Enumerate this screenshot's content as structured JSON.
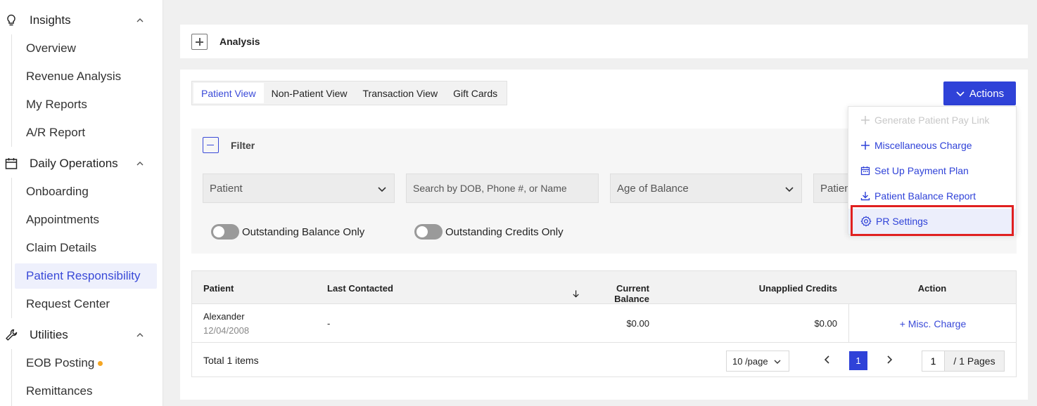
{
  "sidebar": {
    "groups": [
      {
        "label": "Insights",
        "items": [
          "Overview",
          "Revenue Analysis",
          "My Reports",
          "A/R Report"
        ]
      },
      {
        "label": "Daily Operations",
        "items": [
          "Onboarding",
          "Appointments",
          "Claim Details",
          "Patient Responsibility",
          "Request Center"
        ]
      },
      {
        "label": "Utilities",
        "items": [
          "EOB Posting",
          "Remittances"
        ]
      }
    ],
    "active_item": "Patient Responsibility"
  },
  "analysis": {
    "title": "Analysis"
  },
  "tabs": [
    "Patient View",
    "Non-Patient View",
    "Transaction View",
    "Gift Cards"
  ],
  "active_tab": "Patient View",
  "actions_label": "Actions",
  "filter": {
    "title": "Filter",
    "patient_select": "Patient",
    "search_placeholder": "Search by DOB, Phone #, or Name",
    "age_select": "Age of Balance",
    "fourth_select": "Patien",
    "toggle_outstanding_balance": "Outstanding Balance Only",
    "toggle_outstanding_credits": "Outstanding Credits Only"
  },
  "table": {
    "columns": [
      "Patient",
      "Last Contacted",
      "Current Balance",
      "Unapplied Credits",
      "Action"
    ],
    "rows": [
      {
        "patient_name": "Alexander",
        "patient_dob": "12/04/2008",
        "last_contacted": "-",
        "current_balance": "$0.00",
        "unapplied_credits": "$0.00",
        "action": "+ Misc. Charge"
      }
    ],
    "total": "Total 1 items",
    "page_size": "10 /page",
    "current_page": "1",
    "goto_page": "1",
    "total_pages": "/ 1 Pages"
  },
  "actions_menu": {
    "items": [
      "Generate Patient Pay Link",
      "Miscellaneous Charge",
      "Set Up Payment Plan",
      "Patient Balance Report",
      "PR Settings"
    ],
    "disabled_item": "Generate Patient Pay Link",
    "highlighted_item": "PR Settings"
  },
  "colors": {
    "accent": "#2f42d8",
    "active_bg": "#eef0fc",
    "highlight_border": "#e02020",
    "badge": "#f5a623"
  }
}
